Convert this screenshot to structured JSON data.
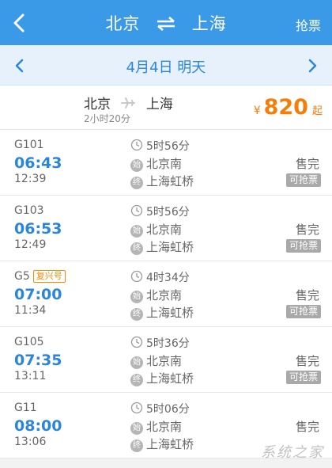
{
  "header": {
    "from": "北京",
    "to": "上海",
    "grab_label": "抢票",
    "back_icon": "chevron-left-icon",
    "swap_icon": "swap-icon"
  },
  "datebar": {
    "date_text": "4月4日 明天",
    "prev_icon": "chevron-left-icon",
    "next_icon": "chevron-right-icon"
  },
  "summary": {
    "from": "北京",
    "to": "上海",
    "duration": "2小时20分",
    "currency": "¥",
    "price": "820",
    "price_suffix": "起",
    "plane_icon": "plane-icon"
  },
  "trains": [
    {
      "number": "G101",
      "tag": "",
      "departure": "06:43",
      "arrival": "12:39",
      "duration": "5时56分",
      "from_station": "北京南",
      "to_station": "上海虹桥",
      "status": "售完",
      "grab": "可抢票"
    },
    {
      "number": "G103",
      "tag": "",
      "departure": "06:53",
      "arrival": "12:49",
      "duration": "5时56分",
      "from_station": "北京南",
      "to_station": "上海虹桥",
      "status": "售完",
      "grab": "可抢票"
    },
    {
      "number": "G5",
      "tag": "复兴号",
      "departure": "07:00",
      "arrival": "11:34",
      "duration": "4时34分",
      "from_station": "北京南",
      "to_station": "上海虹桥",
      "status": "售完",
      "grab": "可抢票"
    },
    {
      "number": "G105",
      "tag": "",
      "departure": "07:35",
      "arrival": "13:11",
      "duration": "5时36分",
      "from_station": "北京南",
      "to_station": "上海虹桥",
      "status": "售完",
      "grab": "可抢票"
    },
    {
      "number": "G11",
      "tag": "",
      "departure": "08:00",
      "arrival": "13:06",
      "duration": "5时06分",
      "from_station": "北京南",
      "to_station": "上海虹桥",
      "status": "售完",
      "grab": ""
    }
  ],
  "labels": {
    "start_badge": "始",
    "end_badge": "终"
  },
  "colors": {
    "primary": "#3b9ae8",
    "accent_blue": "#2b86d8",
    "price_orange": "#f57d0a",
    "tag_orange": "#f08a00"
  },
  "watermark": "系统之家"
}
